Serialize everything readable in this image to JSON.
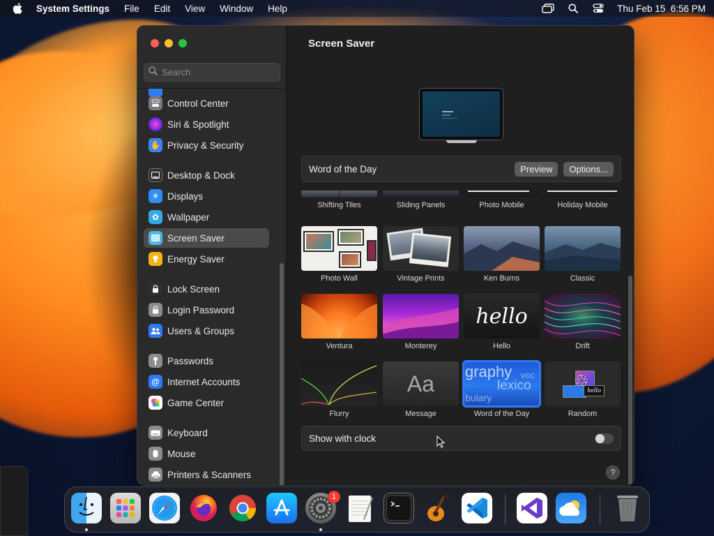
{
  "menubar": {
    "app_name": "System Settings",
    "items": [
      "File",
      "Edit",
      "View",
      "Window",
      "Help"
    ],
    "datetime": "Thu Feb 15  6:56 PM"
  },
  "sidebar": {
    "search_placeholder": "Search",
    "items": [
      {
        "label": "Control Center",
        "icon": "control-center-icon",
        "color": "#7a7a7a"
      },
      {
        "label": "Siri & Spotlight",
        "icon": "siri-icon",
        "color": "#b13cf2"
      },
      {
        "label": "Privacy & Security",
        "icon": "hand-icon",
        "color": "#3b82f6"
      },
      {
        "label": "Desktop & Dock",
        "icon": "dock-icon",
        "color": "#2f2f2f"
      },
      {
        "label": "Displays",
        "icon": "sun-icon",
        "color": "#2f8df6"
      },
      {
        "label": "Wallpaper",
        "icon": "flower-icon",
        "color": "#36a9e8"
      },
      {
        "label": "Screen Saver",
        "icon": "screen-saver-icon",
        "color": "#4fb6e0"
      },
      {
        "label": "Energy Saver",
        "icon": "bulb-icon",
        "color": "#f5b312"
      },
      {
        "label": "Lock Screen",
        "icon": "lock-icon",
        "color": "#2f2f2f"
      },
      {
        "label": "Login Password",
        "icon": "lock-icon",
        "color": "#8c8c8c"
      },
      {
        "label": "Users & Groups",
        "icon": "users-icon",
        "color": "#2f7bf6"
      },
      {
        "label": "Passwords",
        "icon": "key-icon",
        "color": "#8c8c8c"
      },
      {
        "label": "Internet Accounts",
        "icon": "at-icon",
        "color": "#2f7bf6"
      },
      {
        "label": "Game Center",
        "icon": "game-center-icon",
        "color": "#ffffff"
      },
      {
        "label": "Keyboard",
        "icon": "keyboard-icon",
        "color": "#8c8c8c"
      },
      {
        "label": "Mouse",
        "icon": "mouse-icon",
        "color": "#8c8c8c"
      },
      {
        "label": "Printers & Scanners",
        "icon": "printer-icon",
        "color": "#8c8c8c"
      }
    ],
    "selected": "Screen Saver"
  },
  "main": {
    "title": "Screen Saver",
    "current_saver": "Word of the Day",
    "preview_button": "Preview",
    "options_button": "Options...",
    "savers": [
      {
        "label": "Shifting Tiles"
      },
      {
        "label": "Sliding Panels"
      },
      {
        "label": "Photo Mobile"
      },
      {
        "label": "Holiday Mobile"
      },
      {
        "label": "Photo Wall"
      },
      {
        "label": "Vintage Prints"
      },
      {
        "label": "Ken Burns"
      },
      {
        "label": "Classic"
      },
      {
        "label": "Ventura"
      },
      {
        "label": "Monterey"
      },
      {
        "label": "Hello",
        "thumb_text": "hello"
      },
      {
        "label": "Drift"
      },
      {
        "label": "Flurry"
      },
      {
        "label": "Message",
        "thumb_text": "Aa"
      },
      {
        "label": "Word of the Day",
        "thumb_text_1": "graphy",
        "thumb_text_2": "lexico",
        "thumb_text_3": "bulary",
        "thumb_text_4": "voc",
        "selected": true
      },
      {
        "label": "Random"
      }
    ],
    "show_with_clock_label": "Show with clock",
    "show_with_clock": false,
    "help_label": "?"
  },
  "dock": {
    "apps": [
      "Finder",
      "Launchpad",
      "Safari",
      "Firefox",
      "Chrome",
      "App Store",
      "System Settings",
      "TextEdit",
      "Terminal",
      "GarageBand",
      "Visual Studio Code",
      "Visual Studio",
      "Weather",
      "Trash"
    ],
    "badge_count": "1"
  },
  "colors": {
    "accent": "#2f7bf6",
    "window_bg": "#1e1e1e",
    "sidebar_bg": "#2a2a2a"
  }
}
